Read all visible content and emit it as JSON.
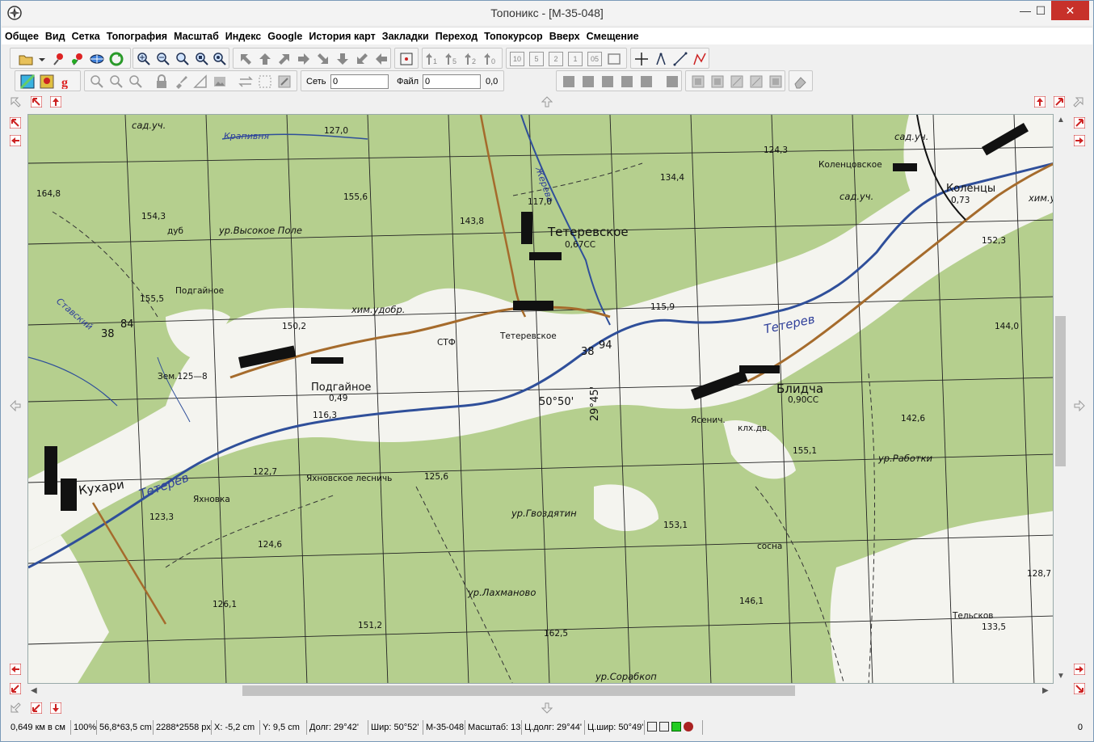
{
  "window": {
    "title": "Топоникс - [M-35-048]",
    "minimize": "—",
    "maximize": "☐",
    "close": "✕"
  },
  "menu": [
    "Общее",
    "Вид",
    "Сетка",
    "Топография",
    "Масштаб",
    "Индекс",
    "Google",
    "История карт",
    "Закладки",
    "Переход",
    "Топокурсор",
    "Вверх",
    "Смещение"
  ],
  "toolbar2": {
    "net_label": "Сеть",
    "net_value": "0",
    "file_label": "Файл",
    "file_value": "0",
    "readout": "0,0"
  },
  "toolbar1_number_buttons": [
    "10",
    "5",
    "2",
    "1",
    "05"
  ],
  "map": {
    "labels": {
      "tetereyskoe": "Тетеревское",
      "tetereyskoe_sub": "0,67СС",
      "tetereyskoe2": "Тетеревское",
      "podgainoe": "Подгайное",
      "podgainoe_sub": "0,49",
      "podgainoe2": "Подгайное",
      "blidcha": "Блидча",
      "blidcha_sub": "0,90СС",
      "kuhari": "Кухари",
      "kolentsy": "Коленцы",
      "kolentsy_sub": "0,73",
      "kolentsovskoe": "Коленцовское",
      "yahnovka": "Яхновка",
      "yahnovskoe": "Яхновское лесничь",
      "vysokoe": "ур.Высокое Поле",
      "raboтki": "ур.Работки",
      "gvozdyatin": "ур.Гвоздятин",
      "lahmanovo": "ур.Лахманово",
      "sorabkop": "ур.Сорабкоп",
      "him": "хим.удобр.",
      "him2": "хим.удо",
      "sad1": "сад.уч.",
      "sad2": "сад.уч.",
      "sad3": "сад.уч.",
      "stf": "СТФ",
      "zem": "Зем.125—8",
      "lat": "50°50'",
      "lon": "29°45'",
      "teterev1": "Тетерев",
      "teterev2": "Тетерев",
      "krapivnya": "Крапивня",
      "zherev": "Жерева",
      "staviski": "Ставский",
      "p164": "164,8",
      "p154": "154,3",
      "p155a": "155,5",
      "p155b": "155,6",
      "p150": "150,2",
      "p143": "143,8",
      "p127": "127,0",
      "p134": "134,4",
      "p124": "124,3",
      "p152": "152,3",
      "p144": "144,0",
      "p142": "142,6",
      "p155c": "155,1",
      "p153": "153,1",
      "p146": "146,1",
      "p133": "133,5",
      "p128": "128,7",
      "p125": "125,6",
      "p122": "122,7",
      "p123": "123,3",
      "p124b": "124,6",
      "p126": "126,1",
      "p151": "151,2",
      "p162": "162,5",
      "p116": "116,3",
      "p117": "117,0",
      "p115": "115,9",
      "grid38a": "38",
      "grid84": "84",
      "grid38b": "38",
      "grid94": "94",
      "sosna": "сосна",
      "kl": "клх.дв.",
      "yasnich": "Ясенич.",
      "telskoe": "Тельсков",
      "dub": "дуб"
    }
  },
  "status": {
    "scale_km": "0,649 км в см",
    "zoom": "100%",
    "size_cm": "56,8*63,5 cm",
    "size_px": "2288*2558 px",
    "x": "X: -5,2 cm",
    "y": "Y: 9,5 cm",
    "lon": "Долг: 29°42'",
    "lat": "Шир: 50°52'",
    "sheet": "M-35-048",
    "scale": "Масштаб: 13",
    "c_lon": "Ц.долг: 29°44'",
    "c_lat": "Ц.шир: 50°49'",
    "right_value": "0"
  },
  "colors": {
    "forest": "#b5cf8e",
    "open": "#f4f4ef",
    "water": "#2f4f9a",
    "road": "#a56b2c",
    "close": "#c7312a"
  }
}
